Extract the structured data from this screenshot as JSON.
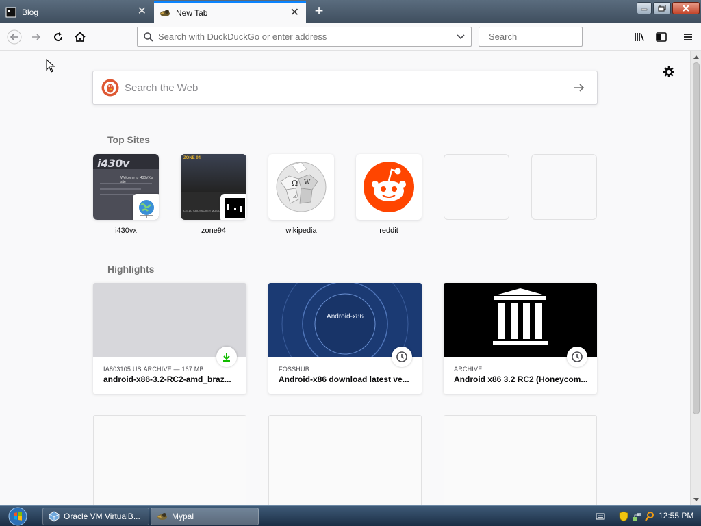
{
  "window": {
    "tabs": [
      {
        "title": "Blog",
        "icon": "blog-favicon-icon",
        "active": false
      },
      {
        "title": "New Tab",
        "icon": "mypal-favicon-icon",
        "active": true
      }
    ],
    "new_tab_symbol": "+",
    "close_symbol": "✕"
  },
  "navbar": {
    "url_placeholder": "Search with DuckDuckGo or enter address",
    "search_placeholder": "Search"
  },
  "newtab": {
    "web_search_placeholder": "Search the Web",
    "top_sites_heading": "Top Sites",
    "highlights_heading": "Highlights",
    "top_sites": [
      {
        "label": "i430vx",
        "thumb_text": "i430v",
        "thumb_sub": "Welcome to i430VX's site"
      },
      {
        "label": "zone94",
        "thumb_text": "ZONE 94",
        "thumb_sub": "CELLO CROSSOVER MUSIC - W"
      },
      {
        "label": "wikipedia"
      },
      {
        "label": "reddit"
      },
      {
        "label": ""
      },
      {
        "label": ""
      }
    ],
    "highlights": [
      {
        "source": "IA803105.US.ARCHIVE — 167 MB",
        "title": "android-x86-3.2-RC2-amd_braz...",
        "status_icon": "download-icon"
      },
      {
        "source": "FOSSHUB",
        "title": "Android-x86 download latest ve...",
        "thumb_text": "Android-x86",
        "status_icon": "clock-icon"
      },
      {
        "source": "ARCHIVE",
        "title": "Android x86 3.2 RC2 (Honeycom...",
        "status_icon": "clock-icon"
      }
    ]
  },
  "taskbar": {
    "items": [
      {
        "label": "Oracle VM VirtualB...",
        "icon": "virtualbox-icon"
      },
      {
        "label": "Mypal",
        "icon": "mypal-icon"
      }
    ],
    "clock": "12:55 PM"
  },
  "colors": {
    "accent": "#0a84ff",
    "reddit": "#ff4500",
    "ddg": "#de5833",
    "fosshub_bg": "#1b3a73",
    "download_green": "#12bc00"
  }
}
